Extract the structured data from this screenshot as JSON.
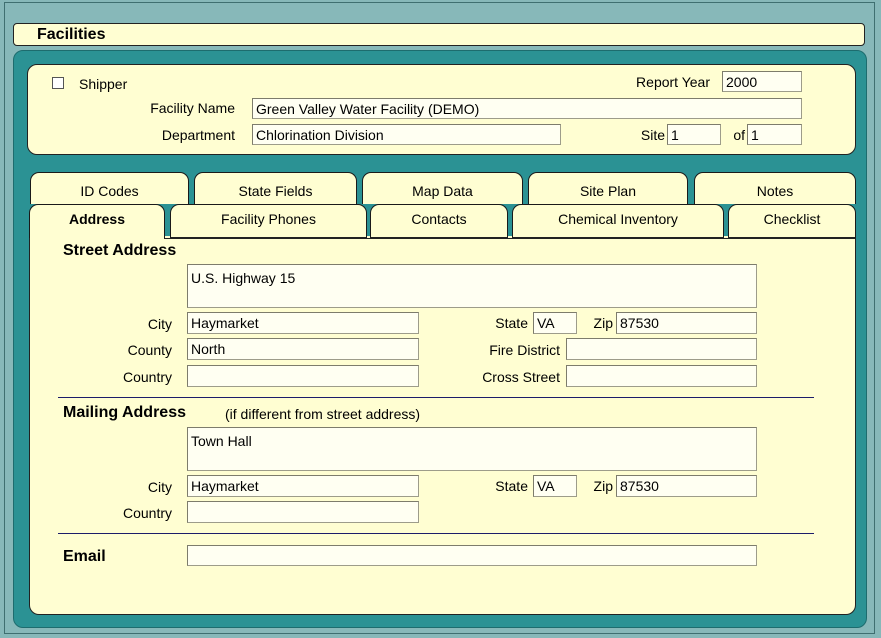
{
  "window": {
    "title": "Facilities"
  },
  "header": {
    "shipper_label": "Shipper",
    "shipper_checked": false,
    "report_year_label": "Report Year",
    "report_year_value": "2000",
    "facility_name_label": "Facility Name",
    "facility_name_value": "Green Valley Water Facility (DEMO)",
    "department_label": "Department",
    "department_value": "Chlorination Division",
    "site_label": "Site",
    "site_value": "1",
    "of_label": "of",
    "of_value": "1"
  },
  "tabs": {
    "back_row": [
      "ID Codes",
      "State Fields",
      "Map Data",
      "Site Plan",
      "Notes"
    ],
    "front_row": [
      "Address",
      "Facility Phones",
      "Contacts",
      "Chemical Inventory",
      "Checklist"
    ],
    "active": "Address"
  },
  "street_address": {
    "title": "Street Address",
    "address_value": "U.S. Highway 15",
    "city_label": "City",
    "city_value": "Haymarket",
    "county_label": "County",
    "county_value": "North",
    "country_label": "Country",
    "country_value": "",
    "state_label": "State",
    "state_value": "VA",
    "zip_label": "Zip",
    "zip_value": "87530",
    "fire_district_label": "Fire District",
    "fire_district_value": "",
    "cross_street_label": "Cross Street",
    "cross_street_value": ""
  },
  "mailing_address": {
    "title": "Mailing Address",
    "subtitle": "(if different from street address)",
    "address_value": "Town Hall",
    "city_label": "City",
    "city_value": "Haymarket",
    "country_label": "Country",
    "country_value": "",
    "state_label": "State",
    "state_value": "VA",
    "zip_label": "Zip",
    "zip_value": "87530"
  },
  "email": {
    "label": "Email",
    "value": ""
  },
  "colors": {
    "background": "#87b8b9",
    "panel": "#fffed2",
    "teal": "#2b9294",
    "rule": "#1c1c6a"
  }
}
